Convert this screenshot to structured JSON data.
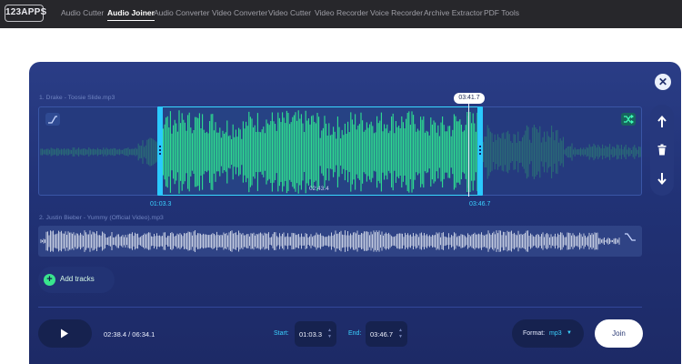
{
  "app": {
    "logo": "123APPS",
    "nav": [
      "Audio Cutter",
      "Audio Joiner",
      "Audio Converter",
      "Video Converter",
      "Video Cutter",
      "Video Recorder",
      "Voice Recorder",
      "Archive Extractor",
      "PDF Tools"
    ],
    "active_nav": "Audio Joiner"
  },
  "tracks": [
    {
      "label": "1. Drake - Toosie Slide.mp3",
      "selection_start": "01:03.3",
      "selection_end": "03:46.7",
      "selection_duration": "02:43.4",
      "playhead_time": "03:41.7",
      "fade_icon": "fade-in-icon",
      "crossfade_icon": "shuffle-icon"
    },
    {
      "label": "2. Justin Bieber - Yummy (Official Video).mp3",
      "fade_icon": "fade-out-icon"
    }
  ],
  "side_controls": [
    "arrow-up-icon",
    "trash-icon",
    "arrow-down-icon"
  ],
  "add_tracks_label": "Add tracks",
  "player": {
    "position": "02:38.4 / 06:34.1",
    "start_label": "Start:",
    "start_value": "01:03.3",
    "end_label": "End:",
    "end_value": "03:46.7",
    "format_label": "Format:",
    "format_value": "mp3",
    "join_label": "Join"
  },
  "colors": {
    "panel": "#213276",
    "wave_active": "#2fe28b",
    "wave_inactive": "#2a6b77",
    "wave_track2": "#c3cbe0",
    "selection": "#2ac9ff",
    "accent": "#3bd2ff"
  }
}
